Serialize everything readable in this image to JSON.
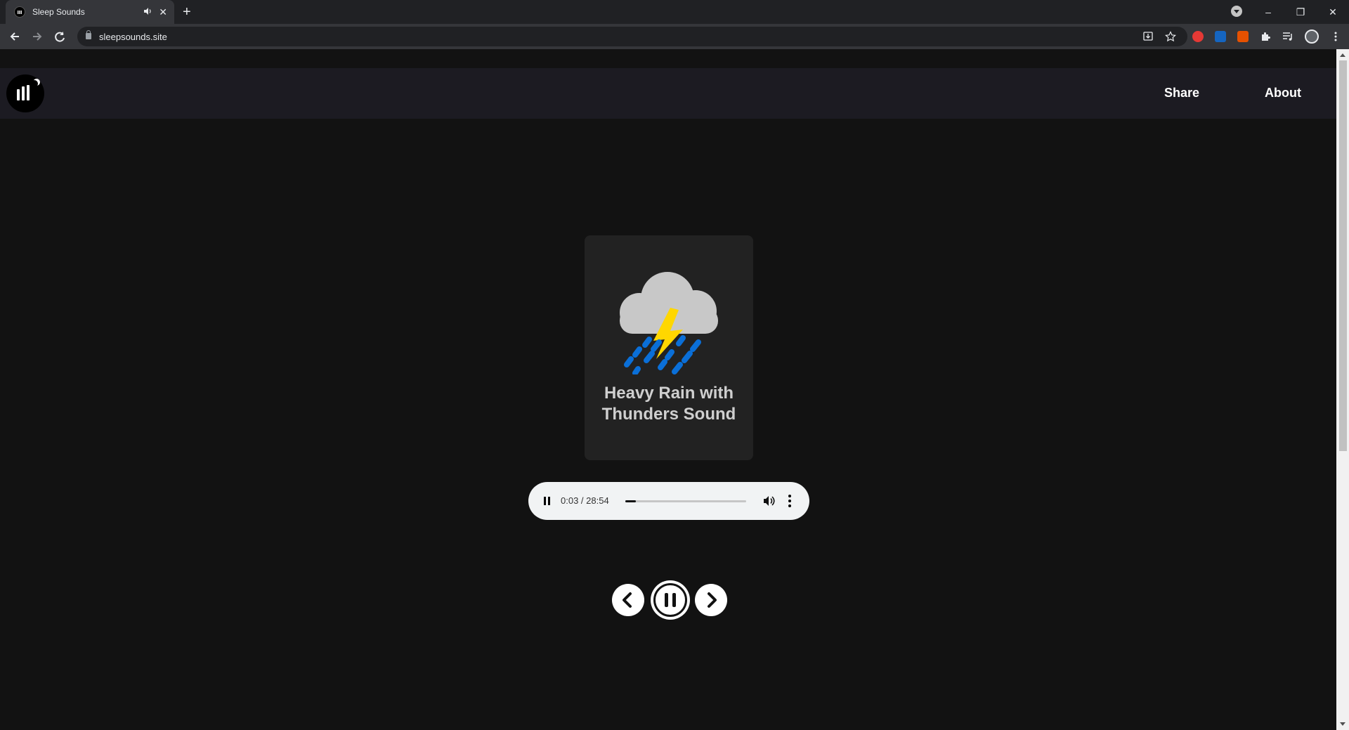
{
  "browser": {
    "tab_title": "Sleep Sounds",
    "tab_speaker_icon": "speaker-icon",
    "tab_close": "✕",
    "new_tab": "+",
    "url": "sleepsounds.site",
    "window_controls": [
      "–",
      "❐",
      "✕"
    ]
  },
  "site": {
    "nav": {
      "share": "Share",
      "about": "About"
    }
  },
  "sound": {
    "title": "Heavy Rain with Thunders Sound"
  },
  "player": {
    "time": "0:03 / 28:54",
    "progress_fraction": 0.002
  },
  "colors": {
    "page_bg": "#121212",
    "header_bg": "#1c1b22",
    "card_bg": "#222222",
    "cloud": "#c8c8c8",
    "bolt": "#ffd700",
    "rain": "#0a6fd8"
  }
}
